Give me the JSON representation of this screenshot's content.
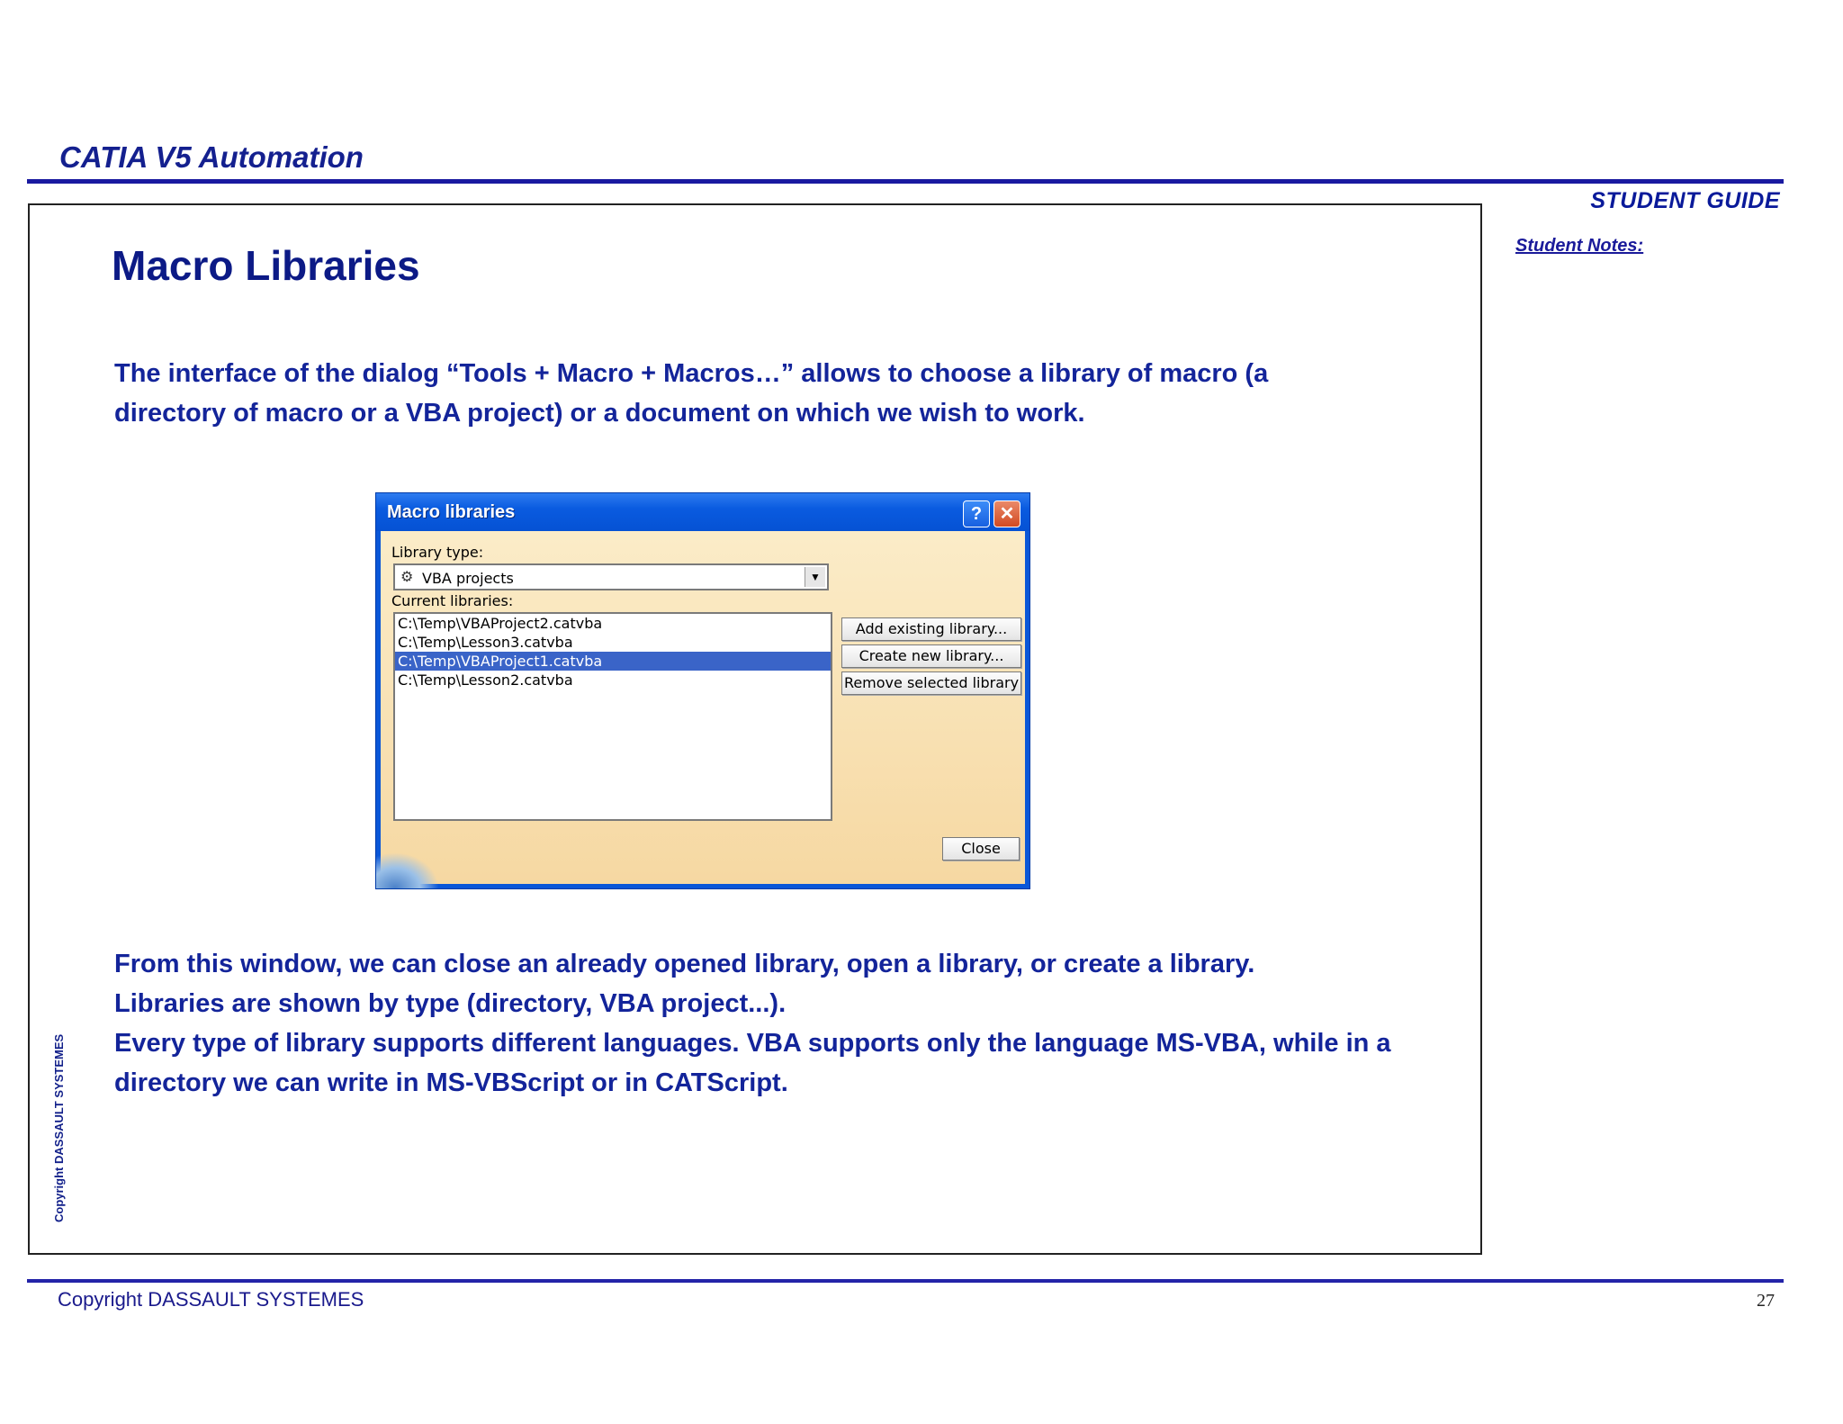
{
  "header": {
    "title": "CATIA V5 Automation",
    "guide_label": "STUDENT GUIDE",
    "notes_label": "Student Notes:"
  },
  "slide": {
    "title": "Macro Libraries",
    "intro": "The interface of the dialog “Tools + Macro + Macros…” allows to choose a library of macro (a directory of macro or a VBA project) or a document on which we wish to work.",
    "body": [
      "From this window, we can close an already opened library, open a library, or create a library.",
      "Libraries are shown by type (directory, VBA project...).",
      "Every type of library supports different languages. VBA supports only the language MS-VBA, while in a directory we can write in MS-VBScript or in CATScript."
    ]
  },
  "dialog": {
    "title": "Macro libraries",
    "help_label": "?",
    "close_x_label": "✕",
    "library_type_label": "Library type:",
    "library_type_value": "VBA projects",
    "current_libraries_label": "Current libraries:",
    "libraries": [
      "C:\\Temp\\VBAProject2.catvba",
      "C:\\Temp\\Lesson3.catvba",
      "C:\\Temp\\VBAProject1.catvba",
      "C:\\Temp\\Lesson2.catvba"
    ],
    "selected_index": 2,
    "add_existing_label": "Add existing library...",
    "create_new_label": "Create new library...",
    "remove_selected_label": "Remove selected library",
    "close_label": "Close"
  },
  "footer": {
    "vertical_copyright": "Copyright DASSAULT SYSTEMES",
    "copyright": "Copyright DASSAULT SYSTEMES",
    "page_number": "27"
  }
}
